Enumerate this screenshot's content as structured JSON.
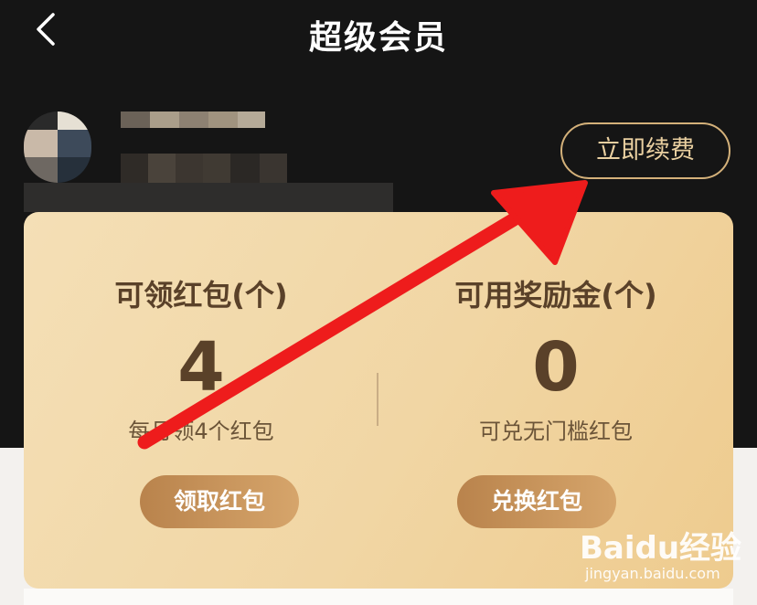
{
  "header": {
    "title": "超级会员"
  },
  "renew_button": {
    "label": "立即续费"
  },
  "card": {
    "left": {
      "label": "可领红包(个)",
      "value": "4",
      "subtext": "每月领4个红包",
      "button": "领取红包"
    },
    "right": {
      "label": "可用奖励金(个)",
      "value": "0",
      "subtext": "可兑无门槛红包",
      "button": "兑换红包"
    }
  },
  "watermark": {
    "logo_text": "Baidu经验",
    "domain": "jingyan.baidu.com"
  },
  "icons": {
    "back": "chevron-left-icon",
    "arrow": "red-arrow-annotation"
  },
  "colors": {
    "header_bg": "#151515",
    "renew_border": "#d4b17a",
    "card_gradient": [
      "#f4dfb6",
      "#eecb8e"
    ],
    "card_text": "#5a4129",
    "button_gradient": [
      "#b9834c",
      "#d6a56b"
    ],
    "arrow": "#ee1c1c"
  }
}
